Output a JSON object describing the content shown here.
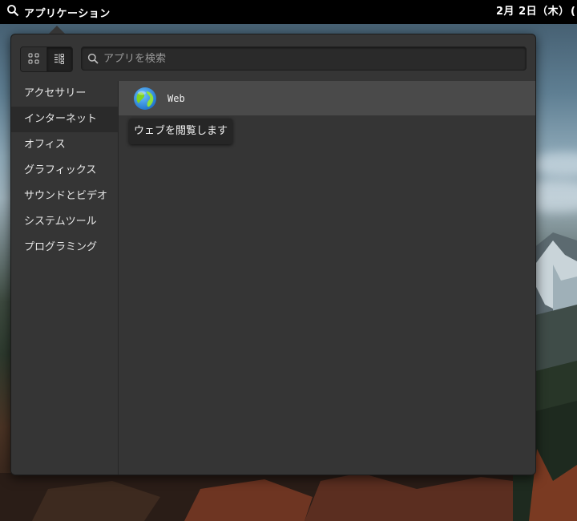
{
  "topbar": {
    "apps_label": "アプリケーション",
    "clock": "2月 2日（木）",
    "right_clip": "("
  },
  "launcher": {
    "search_placeholder": "アプリを検索",
    "view_modes": [
      "grid-view",
      "category-view"
    ],
    "active_view": "category-view",
    "categories": [
      {
        "label": "アクセサリー",
        "active": false
      },
      {
        "label": "インターネット",
        "active": true
      },
      {
        "label": "オフィス",
        "active": false
      },
      {
        "label": "グラフィックス",
        "active": false
      },
      {
        "label": "サウンドとビデオ",
        "active": false
      },
      {
        "label": "システムツール",
        "active": false
      },
      {
        "label": "プログラミング",
        "active": false
      }
    ],
    "apps": [
      {
        "name": "Web",
        "icon": "web-browser-globe-icon"
      }
    ],
    "tooltip": "ウェブを閲覧します"
  }
}
